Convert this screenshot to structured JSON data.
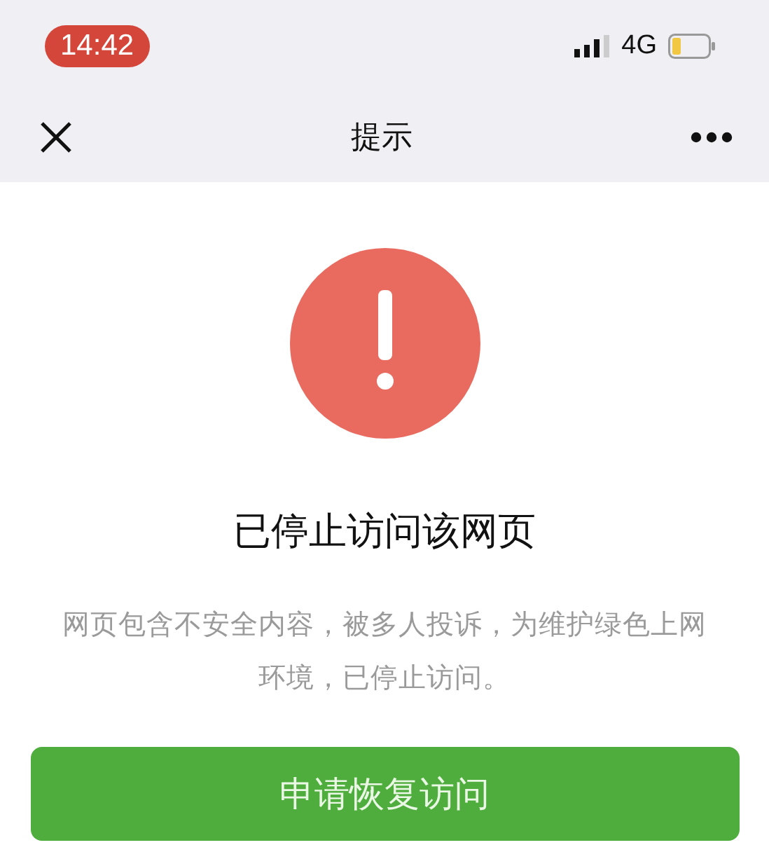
{
  "status_bar": {
    "time": "14:42",
    "network": "4G"
  },
  "nav_bar": {
    "title": "提示"
  },
  "notice": {
    "heading": "已停止访问该网页",
    "message": "网页包含不安全内容，被多人投诉，为维护绿色上网环境，已停止访问。"
  },
  "button": {
    "label": "申请恢复访问"
  }
}
